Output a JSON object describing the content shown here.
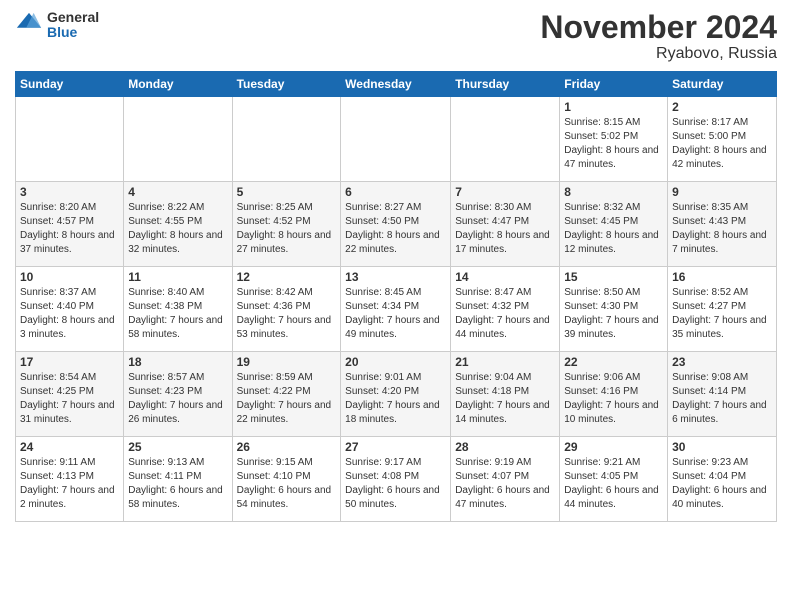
{
  "header": {
    "logo_general": "General",
    "logo_blue": "Blue",
    "month_title": "November 2024",
    "location": "Ryabovo, Russia"
  },
  "weekdays": [
    "Sunday",
    "Monday",
    "Tuesday",
    "Wednesday",
    "Thursday",
    "Friday",
    "Saturday"
  ],
  "weeks": [
    [
      {
        "day": "",
        "info": ""
      },
      {
        "day": "",
        "info": ""
      },
      {
        "day": "",
        "info": ""
      },
      {
        "day": "",
        "info": ""
      },
      {
        "day": "",
        "info": ""
      },
      {
        "day": "1",
        "info": "Sunrise: 8:15 AM\nSunset: 5:02 PM\nDaylight: 8 hours and 47 minutes."
      },
      {
        "day": "2",
        "info": "Sunrise: 8:17 AM\nSunset: 5:00 PM\nDaylight: 8 hours and 42 minutes."
      }
    ],
    [
      {
        "day": "3",
        "info": "Sunrise: 8:20 AM\nSunset: 4:57 PM\nDaylight: 8 hours and 37 minutes."
      },
      {
        "day": "4",
        "info": "Sunrise: 8:22 AM\nSunset: 4:55 PM\nDaylight: 8 hours and 32 minutes."
      },
      {
        "day": "5",
        "info": "Sunrise: 8:25 AM\nSunset: 4:52 PM\nDaylight: 8 hours and 27 minutes."
      },
      {
        "day": "6",
        "info": "Sunrise: 8:27 AM\nSunset: 4:50 PM\nDaylight: 8 hours and 22 minutes."
      },
      {
        "day": "7",
        "info": "Sunrise: 8:30 AM\nSunset: 4:47 PM\nDaylight: 8 hours and 17 minutes."
      },
      {
        "day": "8",
        "info": "Sunrise: 8:32 AM\nSunset: 4:45 PM\nDaylight: 8 hours and 12 minutes."
      },
      {
        "day": "9",
        "info": "Sunrise: 8:35 AM\nSunset: 4:43 PM\nDaylight: 8 hours and 7 minutes."
      }
    ],
    [
      {
        "day": "10",
        "info": "Sunrise: 8:37 AM\nSunset: 4:40 PM\nDaylight: 8 hours and 3 minutes."
      },
      {
        "day": "11",
        "info": "Sunrise: 8:40 AM\nSunset: 4:38 PM\nDaylight: 7 hours and 58 minutes."
      },
      {
        "day": "12",
        "info": "Sunrise: 8:42 AM\nSunset: 4:36 PM\nDaylight: 7 hours and 53 minutes."
      },
      {
        "day": "13",
        "info": "Sunrise: 8:45 AM\nSunset: 4:34 PM\nDaylight: 7 hours and 49 minutes."
      },
      {
        "day": "14",
        "info": "Sunrise: 8:47 AM\nSunset: 4:32 PM\nDaylight: 7 hours and 44 minutes."
      },
      {
        "day": "15",
        "info": "Sunrise: 8:50 AM\nSunset: 4:30 PM\nDaylight: 7 hours and 39 minutes."
      },
      {
        "day": "16",
        "info": "Sunrise: 8:52 AM\nSunset: 4:27 PM\nDaylight: 7 hours and 35 minutes."
      }
    ],
    [
      {
        "day": "17",
        "info": "Sunrise: 8:54 AM\nSunset: 4:25 PM\nDaylight: 7 hours and 31 minutes."
      },
      {
        "day": "18",
        "info": "Sunrise: 8:57 AM\nSunset: 4:23 PM\nDaylight: 7 hours and 26 minutes."
      },
      {
        "day": "19",
        "info": "Sunrise: 8:59 AM\nSunset: 4:22 PM\nDaylight: 7 hours and 22 minutes."
      },
      {
        "day": "20",
        "info": "Sunrise: 9:01 AM\nSunset: 4:20 PM\nDaylight: 7 hours and 18 minutes."
      },
      {
        "day": "21",
        "info": "Sunrise: 9:04 AM\nSunset: 4:18 PM\nDaylight: 7 hours and 14 minutes."
      },
      {
        "day": "22",
        "info": "Sunrise: 9:06 AM\nSunset: 4:16 PM\nDaylight: 7 hours and 10 minutes."
      },
      {
        "day": "23",
        "info": "Sunrise: 9:08 AM\nSunset: 4:14 PM\nDaylight: 7 hours and 6 minutes."
      }
    ],
    [
      {
        "day": "24",
        "info": "Sunrise: 9:11 AM\nSunset: 4:13 PM\nDaylight: 7 hours and 2 minutes."
      },
      {
        "day": "25",
        "info": "Sunrise: 9:13 AM\nSunset: 4:11 PM\nDaylight: 6 hours and 58 minutes."
      },
      {
        "day": "26",
        "info": "Sunrise: 9:15 AM\nSunset: 4:10 PM\nDaylight: 6 hours and 54 minutes."
      },
      {
        "day": "27",
        "info": "Sunrise: 9:17 AM\nSunset: 4:08 PM\nDaylight: 6 hours and 50 minutes."
      },
      {
        "day": "28",
        "info": "Sunrise: 9:19 AM\nSunset: 4:07 PM\nDaylight: 6 hours and 47 minutes."
      },
      {
        "day": "29",
        "info": "Sunrise: 9:21 AM\nSunset: 4:05 PM\nDaylight: 6 hours and 44 minutes."
      },
      {
        "day": "30",
        "info": "Sunrise: 9:23 AM\nSunset: 4:04 PM\nDaylight: 6 hours and 40 minutes."
      }
    ]
  ]
}
